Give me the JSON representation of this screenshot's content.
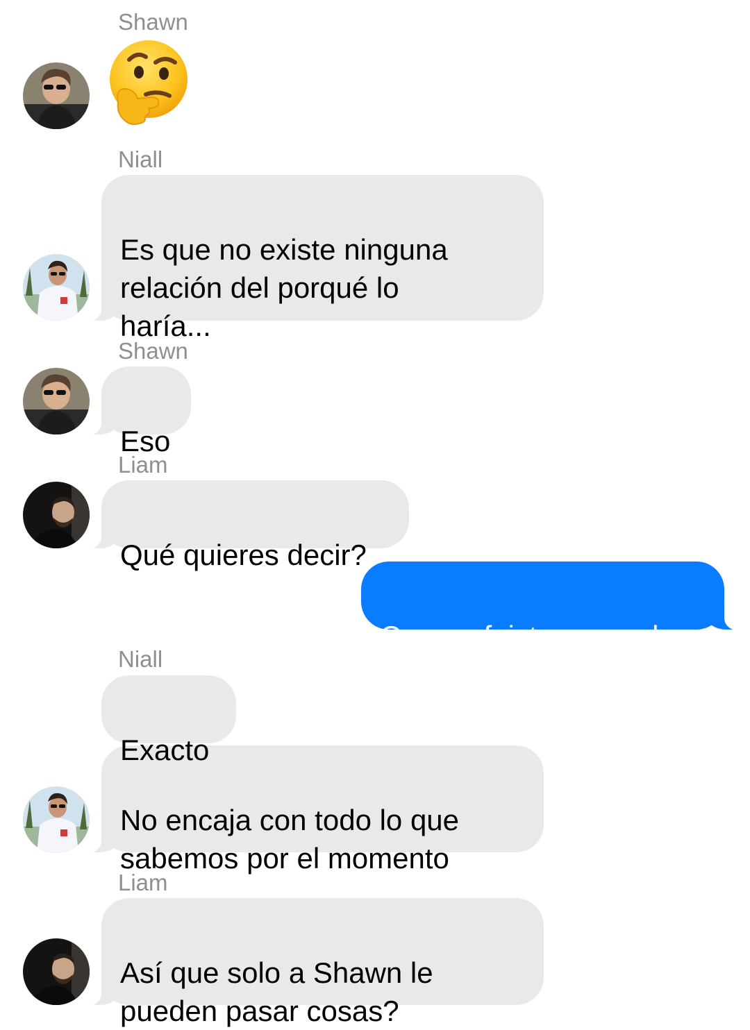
{
  "messages": [
    {
      "sender": "Shawn",
      "text": "🤔"
    },
    {
      "sender": "Niall",
      "text": "Es que no existe ninguna\nrelación del porqué lo\nharía..."
    },
    {
      "sender": "Shawn",
      "text": "Eso"
    },
    {
      "sender": "Liam",
      "text": "Qué quieres decir?"
    },
    {
      "sender": "",
      "text": "Que no fuiste marcado"
    },
    {
      "sender": "Niall",
      "text": "Exacto"
    },
    {
      "sender": "",
      "text": "No encaja con todo lo que\nsabemos por el momento"
    },
    {
      "sender": "Liam",
      "text": "Así que solo a Shawn le\npueden pasar cosas?"
    }
  ],
  "colors": {
    "incoming_bubble": "#e9e9eb",
    "outgoing_bubble": "#0a7cff",
    "sender_label": "#8e8e93"
  },
  "icons": {
    "emoji": "thinking-face-emoji",
    "avatars": [
      "shawn-avatar",
      "niall-avatar",
      "liam-avatar"
    ]
  }
}
